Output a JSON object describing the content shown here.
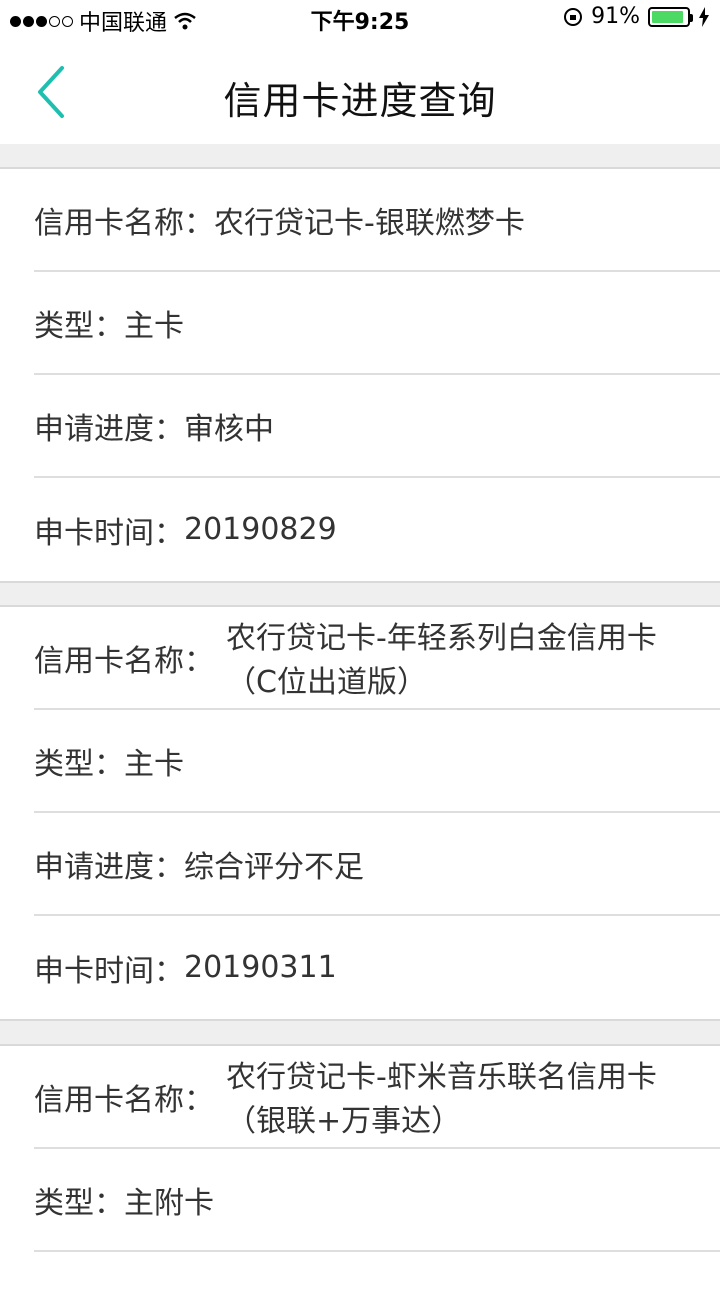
{
  "status_bar": {
    "carrier": "中国联通",
    "time": "下午9:25",
    "battery_percent": "91%",
    "battery_level": 0.91
  },
  "header": {
    "title": "信用卡进度查询",
    "back_icon": "chevron-left-icon",
    "accent_color": "#1fbfb0"
  },
  "cards": [
    {
      "name_label": "信用卡名称：",
      "name_value": "农行贷记卡-银联燃梦卡",
      "type_label": "类型：",
      "type_value": "主卡",
      "progress_label": "申请进度：",
      "progress_value": "审核中",
      "time_label": "申卡时间：",
      "time_value": "20190829"
    },
    {
      "name_label": "信用卡名称：",
      "name_value": "农行贷记卡-年轻系列白金信用卡（C位出道版）",
      "type_label": "类型：",
      "type_value": "主卡",
      "progress_label": "申请进度：",
      "progress_value": "综合评分不足",
      "time_label": "申卡时间：",
      "time_value": "20190311"
    },
    {
      "name_label": "信用卡名称：",
      "name_value": "农行贷记卡-虾米音乐联名信用卡（银联+万事达）",
      "type_label": "类型：",
      "type_value": "主附卡"
    }
  ]
}
